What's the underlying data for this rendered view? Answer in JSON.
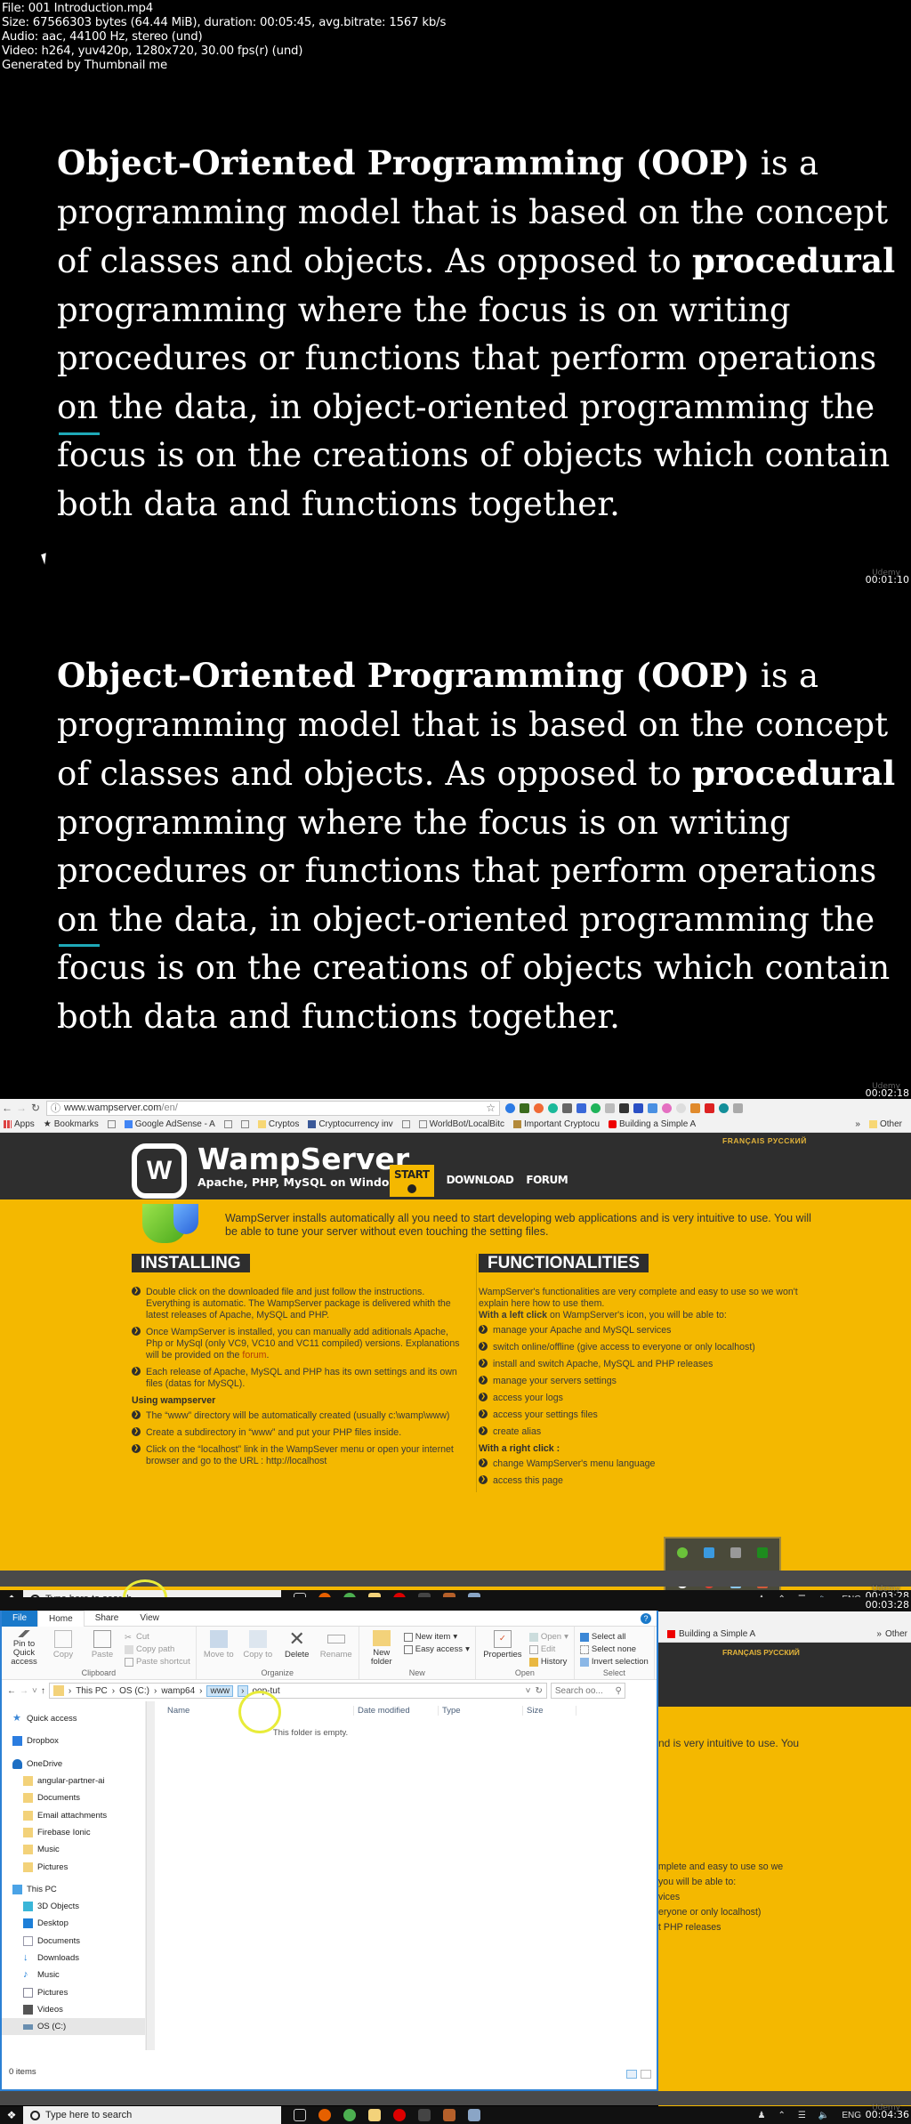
{
  "file_info": {
    "lines": [
      "File: 001 Introduction.mp4",
      "Size: 67566303 bytes (64.44 MiB), duration: 00:05:45, avg.bitrate: 1567 kb/s",
      "Audio: aac, 44100 Hz, stereo (und)",
      "Video: h264, yuv420p, 1280x720, 30.00 fps(r) (und)",
      "Generated by Thumbnail me"
    ]
  },
  "frames": [
    {
      "timestamp": "00:01:10"
    },
    {
      "timestamp": "00:02:18"
    },
    {
      "timestamp": "00:03:28"
    },
    {
      "timestamp": "00:04:36"
    }
  ],
  "watermark": "Udemy",
  "slide": {
    "term": "Object-Oriented Programming (OOP)",
    "part1": " is a programming model that is based on the concept of classes and objects. As opposed to ",
    "emph": "procedural",
    "part2": " programming where the focus is on writing procedures or functions that perform operations on the data, in object-oriented programming the focus is on the creations of objects which contain both data and functions together."
  },
  "browser": {
    "url_host": "www.wampserver.com",
    "url_path": "/en/",
    "bookmarks": [
      "Apps",
      "Bookmarks",
      "Google AdSense - A",
      "Cryptos",
      "Cryptocurrency inv",
      "WorldBot/LocalBitc",
      "Important Cryptocu",
      "Building a Simple A"
    ],
    "overflow": "»",
    "other_bookmarks": "Other",
    "languages": "FRANÇAIS  РУССКИЙ"
  },
  "wamp": {
    "logo_letter": "W",
    "title": "WampServer",
    "subtitle": "Apache, PHP, MySQL on Windows",
    "nav": [
      "START",
      "DOWNLOAD",
      "FORUM"
    ],
    "intro": "WampServer installs automatically all you need to start developing web applications and is very intuitive to use. You will be able to tune your server without even touching the setting files.",
    "installing": {
      "heading": "INSTALLING",
      "bullets": [
        "Double click on the downloaded file and just follow the instructions. Everything is automatic. The WampServer package is delivered whith the latest releases of Apache, MySQL and PHP.",
        "Once WampServer is installed, you can manually add aditionals Apache, Php or MySql (only VC9, VC10 and VC11 compiled) versions. Explanations will be provided on the",
        "Each release of Apache, MySQL and PHP has its own settings and its own files (datas for MySQL)."
      ],
      "forum_link": "forum",
      "using_heading": "Using wampserver",
      "using_bullets": [
        "The “www” directory will be automatically created (usually c:\\wamp\\www)",
        "Create a subdirectory in “www” and put your PHP files inside.",
        "Click on the “localhost” link in the WampSever menu or open your internet browser and go to the URL : http://localhost"
      ]
    },
    "functionalities": {
      "heading": "FUNCTIONALITIES",
      "intro": "WampServer's functionalities are very complete and easy to use so we won't explain here how to use them.",
      "left_click_bold": "With a left click",
      "left_click_rest": " on WampServer's icon, you will be able to:",
      "left_bullets": [
        "manage your Apache and MySQL services",
        "switch online/offline (give access to everyone or only localhost)",
        "install and switch Apache, MySQL and PHP releases",
        "manage your servers settings",
        "access your logs",
        "access your settings files",
        "create alias"
      ],
      "right_click": "With a right click :",
      "right_bullets": [
        "change WampServer's menu language",
        "access this page"
      ]
    },
    "partial_right": {
      "intro_tail": "nd is very intuitive to use. You",
      "func_tail": "mplete and easy to use so we",
      "able_tail": "you will be able to:",
      "b1_tail": "vices",
      "b2_tail": "eryone or only localhost)",
      "b3_tail": "t PHP releases"
    }
  },
  "taskbar": {
    "search_placeholder": "Type here to search",
    "language": "ENG"
  },
  "explorer": {
    "tabs": [
      "File",
      "Home",
      "Share",
      "View"
    ],
    "active_tab": "Home",
    "ribbon": {
      "clipboard": {
        "label": "Clipboard",
        "pin": "Pin to Quick access",
        "copy": "Copy",
        "paste": "Paste",
        "cut": "Cut",
        "copy_path": "Copy path",
        "paste_shortcut": "Paste shortcut"
      },
      "organize": {
        "label": "Organize",
        "move_to": "Move to",
        "copy_to": "Copy to",
        "delete": "Delete",
        "rename": "Rename"
      },
      "new": {
        "label": "New",
        "new_folder": "New folder",
        "new_item": "New item",
        "easy_access": "Easy access"
      },
      "open": {
        "label": "Open",
        "properties": "Properties",
        "open": "Open",
        "edit": "Edit",
        "history": "History"
      },
      "select": {
        "label": "Select",
        "select_all": "Select all",
        "select_none": "Select none",
        "invert": "Invert selection"
      }
    },
    "path": [
      "This PC",
      "OS (C:)",
      "wamp64",
      "www",
      "oop-tut"
    ],
    "search_placeholder": "Search oo...",
    "columns": [
      "Name",
      "Date modified",
      "Type",
      "Size"
    ],
    "empty_message": "This folder is empty.",
    "nav": {
      "quick_access": "Quick access",
      "dropbox": "Dropbox",
      "onedrive": "OneDrive",
      "onedrive_folders": [
        "angular-partner-ai",
        "Documents",
        "Email attachments",
        "Firebase Ionic",
        "Music",
        "Pictures"
      ],
      "this_pc": "This PC",
      "pc_items": [
        "3D Objects",
        "Desktop",
        "Documents",
        "Downloads",
        "Music",
        "Pictures",
        "Videos",
        "OS (C:)"
      ]
    },
    "status": "0 items"
  }
}
